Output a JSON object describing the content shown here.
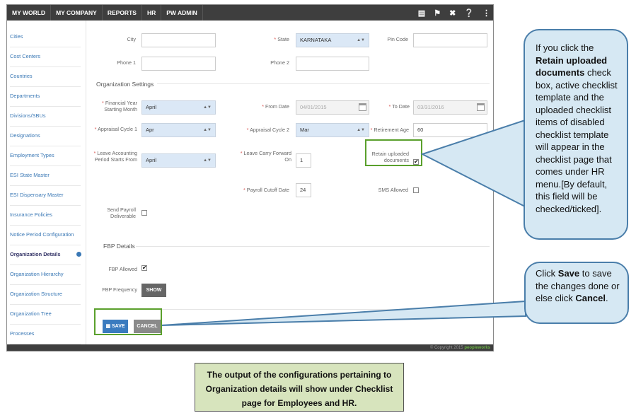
{
  "topnav": [
    "MY WORLD",
    "MY COMPANY",
    "REPORTS",
    "HR",
    "PW ADMIN"
  ],
  "topicons": [
    "book-icon",
    "pin-icon",
    "tools-icon",
    "help-icon",
    "share-icon"
  ],
  "sidebar": [
    "Cities",
    "Cost Centers",
    "Countries",
    "Departments",
    "Divisions/SBUs",
    "Designations",
    "Employment Types",
    "ESI State Master",
    "ESI Dispensary Master",
    "Insurance Policies",
    "Notice Period Configuration",
    "Organization Details",
    "Organization Hierarchy",
    "Organization Structure",
    "Organization Tree",
    "Processes"
  ],
  "sidebar_active": "Organization Details",
  "form": {
    "city_label": "City",
    "city_value": "",
    "state_label": "State",
    "state_value": "KARNATAKA",
    "pincode_label": "Pin Code",
    "pincode_value": "",
    "phone1_label": "Phone 1",
    "phone1_value": "",
    "phone2_label": "Phone 2",
    "phone2_value": "",
    "org_settings_title": "Organization Settings",
    "fy_label": "Financial Year Starting Month",
    "fy_value": "April",
    "from_label": "From Date",
    "from_value": "04/01/2015",
    "to_label": "To Date",
    "to_value": "03/31/2016",
    "appraisal1_label": "Appraisal Cycle 1",
    "appraisal1_value": "Apr",
    "appraisal2_label": "Appraisal Cycle 2",
    "appraisal2_value": "Mar",
    "retire_label": "Retirement Age",
    "retire_value": "60",
    "leave_label": "Leave Accounting Period Starts From",
    "leave_value": "April",
    "carry_label": "Leave Carry Forward On",
    "carry_value": "1",
    "retain_label": "Retain uploaded documents",
    "retain_checked": "✔",
    "cutoff_label": "Payroll Cutoff Date",
    "cutoff_value": "24",
    "sms_label": "SMS Allowed",
    "payroll_label": "Send Payroll Deliverable",
    "fbp_title": "FBP Details",
    "fbp_allowed_label": "FBP Allowed",
    "fbp_allowed_checked": "✔",
    "fbp_freq_label": "FBP Frequency",
    "fbp_show_button": "SHOW",
    "save_button": "SAVE",
    "cancel_button": "CANCEL"
  },
  "footer": {
    "copyright": "© Copyright 2015",
    "brand": "peopleworks"
  },
  "callout1": {
    "t1": "If you click the ",
    "b1": "Retain uploaded documents",
    "t2": " check box, active checklist template and the uploaded checklist items of disabled checklist template will appear in the checklist page that comes under HR menu.[By default, this field will be checked/ticked]."
  },
  "callout2": {
    "t1": "Click ",
    "b1": "Save",
    "t2": " to save the changes done or else click ",
    "b2": "Cancel",
    "t3": "."
  },
  "note": "The output of the configurations pertaining to Organization details will show under Checklist page for Employees and HR.",
  "colors": {
    "topbar": "#3e3e3e",
    "accent": "#3a78b5",
    "save": "#3a7bbf",
    "cancel": "#8a8a8a",
    "highlight": "#5aa02c",
    "callout_fill": "#d6e8f3",
    "note_fill": "#d7e4bd"
  }
}
